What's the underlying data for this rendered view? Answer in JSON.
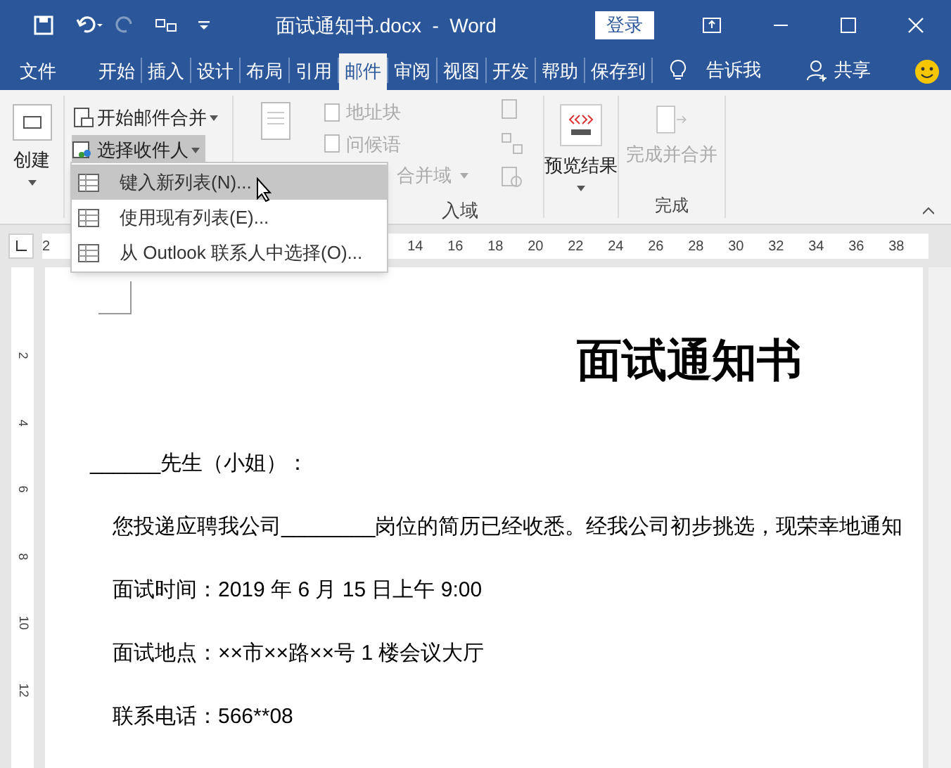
{
  "window": {
    "title": "面试通知书.docx  -  Word",
    "login": "登录"
  },
  "tabs": [
    {
      "label": "文件",
      "selected": false
    },
    {
      "label": "开始",
      "selected": false
    },
    {
      "label": "插入",
      "selected": false
    },
    {
      "label": "设计",
      "selected": false
    },
    {
      "label": "布局",
      "selected": false
    },
    {
      "label": "引用",
      "selected": false
    },
    {
      "label": "邮件",
      "selected": true
    },
    {
      "label": "审阅",
      "selected": false
    },
    {
      "label": "视图",
      "selected": false
    },
    {
      "label": "开发",
      "selected": false
    },
    {
      "label": "帮助",
      "selected": false
    },
    {
      "label": "保存到",
      "selected": false
    }
  ],
  "tell_me": "告诉我",
  "share": "共享",
  "ribbon": {
    "create": "创建",
    "start_merge": "开始邮件合并",
    "select_recipients": "选择收件人",
    "address_block": "地址块",
    "greeting": "问候语",
    "insert_field": "合并域",
    "group_write": "入域",
    "preview": "预览结果",
    "finish": "完成并合并",
    "group_finish": "完成"
  },
  "menu": [
    {
      "label": "键入新列表(N)...",
      "selected": true
    },
    {
      "label": "使用现有列表(E)...",
      "selected": false
    },
    {
      "label": "从 Outlook 联系人中选择(O)...",
      "selected": false
    }
  ],
  "ruler": [
    "2",
    "14",
    "16",
    "18",
    "20",
    "22",
    "24",
    "26",
    "28",
    "30",
    "32",
    "34",
    "36",
    "38"
  ],
  "vruler": [
    "2",
    "4",
    "6",
    "8",
    "10",
    "12"
  ],
  "document": {
    "title": "面试通知书",
    "paragraphs": [
      "______先生（小姐）：",
      "您投递应聘我公司________岗位的简历已经收悉。经我公司初步挑选，现荣幸地通知",
      "面试时间：2019 年 6 月 15 日上午 9:00",
      "面试地点：××市××路××号 1 楼会议大厅",
      "联系电话：566**08"
    ]
  }
}
